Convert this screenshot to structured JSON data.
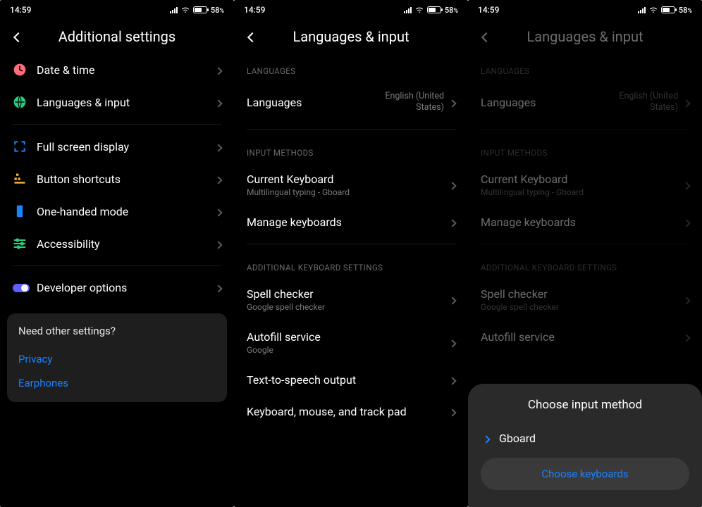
{
  "status": {
    "time": "14:59",
    "battery_pct": "58",
    "battery_unit": "%"
  },
  "pane1": {
    "title": "Additional settings",
    "items": [
      {
        "label": "Date & time"
      },
      {
        "label": "Languages & input"
      },
      {
        "label": "Full screen display"
      },
      {
        "label": "Button shortcuts"
      },
      {
        "label": "One-handed mode"
      },
      {
        "label": "Accessibility"
      },
      {
        "label": "Developer options"
      }
    ],
    "card": {
      "heading": "Need other settings?",
      "links": [
        "Privacy",
        "Earphones"
      ]
    }
  },
  "pane2": {
    "title": "Languages & input",
    "sections": {
      "languages": {
        "label": "LANGUAGES",
        "item": {
          "label": "Languages",
          "value": "English (United States)"
        }
      },
      "input_methods": {
        "label": "INPUT METHODS",
        "items": [
          {
            "label": "Current Keyboard",
            "sub": "Multilingual typing - Gboard"
          },
          {
            "label": "Manage keyboards"
          }
        ]
      },
      "additional": {
        "label": "ADDITIONAL KEYBOARD SETTINGS",
        "items": [
          {
            "label": "Spell checker",
            "sub": "Google spell checker"
          },
          {
            "label": "Autofill service",
            "sub": "Google"
          },
          {
            "label": "Text-to-speech output"
          },
          {
            "label": "Keyboard, mouse, and track pad"
          }
        ]
      }
    }
  },
  "pane3": {
    "sheet": {
      "title": "Choose input method",
      "option": "Gboard",
      "button": "Choose keyboards"
    }
  }
}
